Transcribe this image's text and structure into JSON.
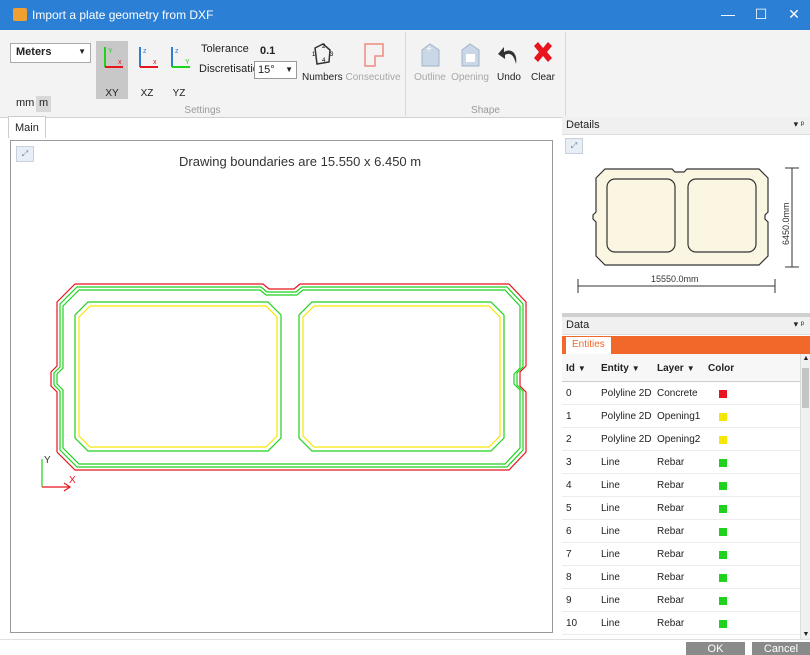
{
  "window": {
    "title": "Import a plate geometry from DXF",
    "minimize_glyph": "—",
    "maximize_glyph": "☐",
    "close_glyph": "✕"
  },
  "ribbon": {
    "units": {
      "selected": "Meters",
      "mm_label": "mm",
      "m_label": "m"
    },
    "planes": [
      {
        "label": "XY",
        "axis_h": "x",
        "axis_v": "Y",
        "active": true
      },
      {
        "label": "XZ",
        "axis_h": "x",
        "axis_v": "z",
        "active": false
      },
      {
        "label": "YZ",
        "axis_h": "Y",
        "axis_v": "z",
        "active": false
      }
    ],
    "tolerance_label": "Tolerance",
    "tolerance_value": "0.1",
    "discretisation_label": "Discretisation",
    "discretisation_value": "15°",
    "numbers_label": "Numbers",
    "consecutive_label": "Consecutive",
    "settings_group_label": "Settings",
    "outline_label": "Outline",
    "opening_label": "Opening",
    "undo_label": "Undo",
    "clear_label": "Clear",
    "shape_group_label": "Shape"
  },
  "main": {
    "tab_label": "Main",
    "boundary_text": "Drawing boundaries are 15.550 x 6.450 m",
    "axis_y_label": "Y",
    "axis_x_label": "X"
  },
  "details": {
    "header": "Details",
    "pane_controls": "▾  ᵖ",
    "width_dimension": "15550.0mm",
    "height_dimension": "6450.0mm"
  },
  "data": {
    "header": "Data",
    "pane_controls": "▾  ᵖ",
    "entities_tab": "Entities",
    "columns": [
      "Id",
      "Entity",
      "Layer",
      "Color"
    ],
    "filter_glyph": "▼",
    "rows": [
      {
        "id": "0",
        "entity": "Polyline 2D",
        "layer": "Concrete",
        "color": "#e8141e"
      },
      {
        "id": "1",
        "entity": "Polyline 2D",
        "layer": "Opening1",
        "color": "#f5e60a"
      },
      {
        "id": "2",
        "entity": "Polyline 2D",
        "layer": "Opening2",
        "color": "#f5e60a"
      },
      {
        "id": "3",
        "entity": "Line",
        "layer": "Rebar",
        "color": "#1ed21e"
      },
      {
        "id": "4",
        "entity": "Line",
        "layer": "Rebar",
        "color": "#1ed21e"
      },
      {
        "id": "5",
        "entity": "Line",
        "layer": "Rebar",
        "color": "#1ed21e"
      },
      {
        "id": "6",
        "entity": "Line",
        "layer": "Rebar",
        "color": "#1ed21e"
      },
      {
        "id": "7",
        "entity": "Line",
        "layer": "Rebar",
        "color": "#1ed21e"
      },
      {
        "id": "8",
        "entity": "Line",
        "layer": "Rebar",
        "color": "#1ed21e"
      },
      {
        "id": "9",
        "entity": "Line",
        "layer": "Rebar",
        "color": "#1ed21e"
      },
      {
        "id": "10",
        "entity": "Line",
        "layer": "Rebar",
        "color": "#1ed21e"
      }
    ]
  },
  "footer": {
    "ok_label": "OK",
    "cancel_label": "Cancel"
  },
  "colors": {
    "titlebar": "#2b7fd4",
    "accent_orange": "#f2682a",
    "concrete_outline": "#e8141e",
    "opening_outline": "#f5e60a",
    "rebar": "#1ed21e"
  }
}
